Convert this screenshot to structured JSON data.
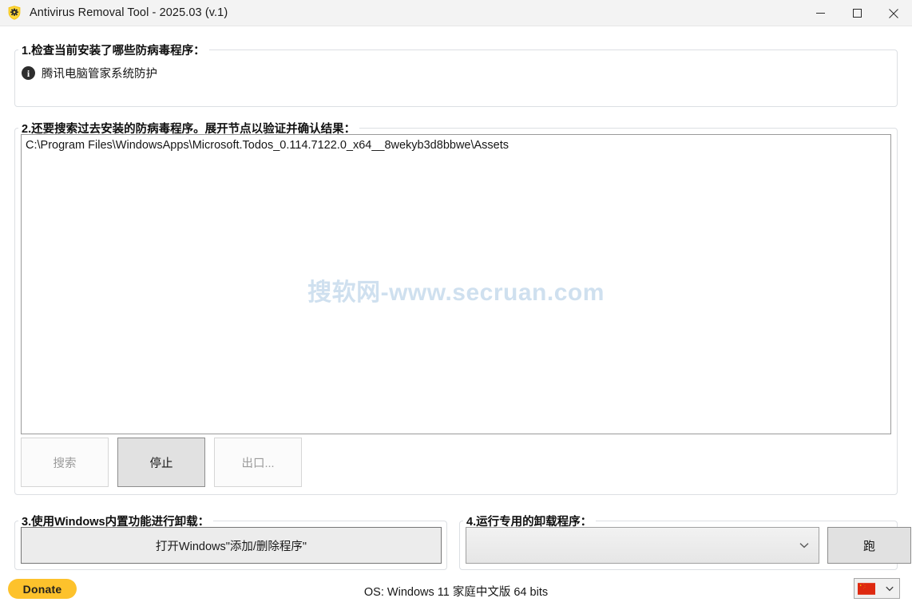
{
  "window": {
    "title": "Antivirus Removal Tool - 2025.03 (v.1)",
    "icon": "shield-gear-icon",
    "minimize_label": "minimize-icon",
    "maximize_label": "maximize-icon",
    "close_label": "close-icon"
  },
  "section1": {
    "legend": "1.检查当前安装了哪些防病毒程序：",
    "items": [
      {
        "icon": "info-icon",
        "name": "腾讯电脑管家系统防护"
      }
    ]
  },
  "section2": {
    "legend": "2.还要搜索过去安装的防病毒程序。展开节点以验证并确认结果：",
    "tree_rows": [
      "C:\\Program Files\\WindowsApps\\Microsoft.Todos_0.114.7122.0_x64__8wekyb3d8bbwe\\Assets"
    ],
    "watermark": "搜软网-www.secruan.com",
    "buttons": [
      {
        "label": "搜索",
        "state": "disabled"
      },
      {
        "label": "停止",
        "state": "enabled"
      },
      {
        "label": "出口...",
        "state": "disabled"
      }
    ]
  },
  "section3": {
    "legend": "3.使用Windows内置功能进行卸载：",
    "button_label": "打开Windows\"添加/删除程序\""
  },
  "section4": {
    "legend": "4.运行专用的卸载程序：",
    "combo_value": "",
    "combo_placeholder": "",
    "run_label": "跑"
  },
  "footer": {
    "donate_label": "Donate",
    "os_text": "OS: Windows 11 家庭中文版 64 bits",
    "language": "中文 (简体)",
    "language_flag": "china-flag-icon"
  },
  "colors": {
    "donate": "#fdc22c",
    "watermark": "#cfe0ef",
    "titlebar": "#f3f3f3",
    "enabled_button": "#e1e1e1",
    "flag_red": "#de2910",
    "flag_yellow": "#ffde00"
  }
}
